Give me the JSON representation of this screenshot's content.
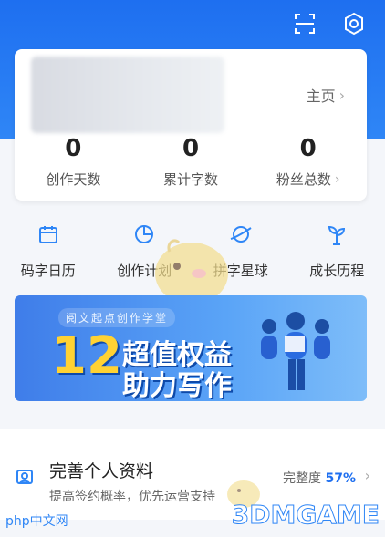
{
  "top_actions": {
    "scan_icon": "scan-icon",
    "settings_icon": "settings-icon"
  },
  "profile": {
    "home_label": "主页",
    "stats": [
      {
        "value": "0",
        "label": "创作天数",
        "has_chevron": false
      },
      {
        "value": "0",
        "label": "累计字数",
        "has_chevron": false
      },
      {
        "value": "0",
        "label": "粉丝总数",
        "has_chevron": true
      }
    ]
  },
  "shortcuts": [
    {
      "label": "码字日历",
      "icon": "calendar-icon"
    },
    {
      "label": "创作计划",
      "icon": "pie-chart-icon"
    },
    {
      "label": "拼字星球",
      "icon": "planet-icon"
    },
    {
      "label": "成长历程",
      "icon": "sprout-icon"
    }
  ],
  "banner": {
    "small_text": "阅文起点创作学堂",
    "big_number": "12",
    "line1": "超值权益",
    "line2": "助力写作"
  },
  "complete_profile": {
    "title": "完善个人资料",
    "subtitle": "提高签约概率，优先运营支持",
    "progress_label": "完整度",
    "progress_value": "57%"
  },
  "watermarks": {
    "left": "php中文网",
    "right": "3DMGAME"
  },
  "colors": {
    "accent": "#1e6ff0",
    "banner": "#4a8ff2",
    "number_yellow": "#ffd233"
  }
}
